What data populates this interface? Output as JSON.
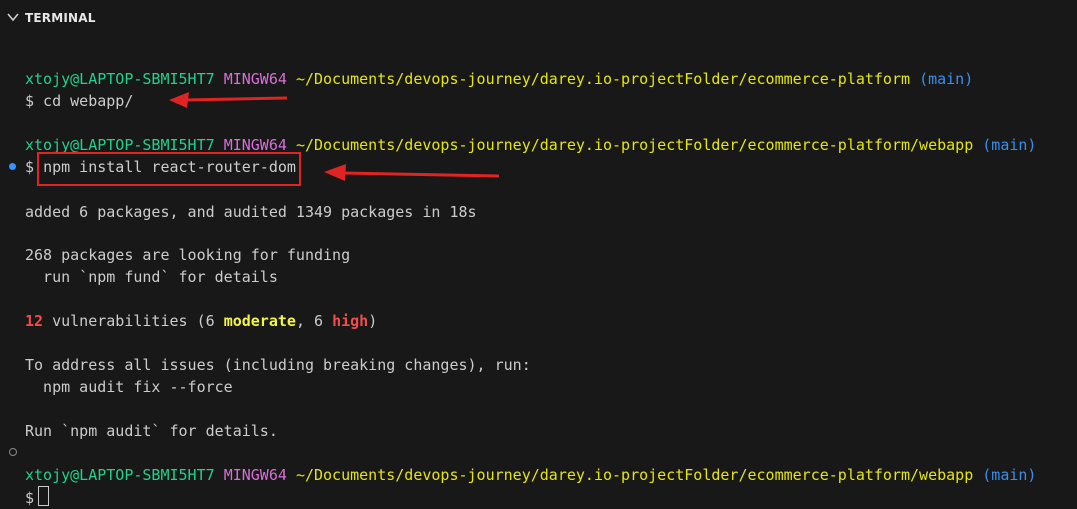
{
  "header": {
    "title": "TERMINAL",
    "icon": "chevron-down-icon"
  },
  "lines": [
    {
      "user": "xtojy@LAPTOP-SBMI5HT7",
      "msys": "MINGW64",
      "path": "~/Documents/devops-journey/darey.io-projectFolder/ecommerce-platform",
      "branch": "(main)"
    },
    {
      "text": "$ cd webapp/"
    },
    {
      "user": "xtojy@LAPTOP-SBMI5HT7",
      "msys": "MINGW64",
      "path": "~/Documents/devops-journey/darey.io-projectFolder/ecommerce-platform/webapp",
      "branch": "(main)"
    },
    {
      "prompt": "$",
      "command": "npm install react-router-dom"
    },
    {
      "text": "added 6 packages, and audited 1349 packages in 18s"
    },
    {
      "text": "268 packages are looking for funding"
    },
    {
      "text": "  run `npm fund` for details"
    },
    {
      "count": "12",
      "mid1": " vulnerabilities (6 ",
      "moderate": "moderate",
      "mid2": ", 6 ",
      "high": "high",
      "end": ")"
    },
    {
      "text": "To address all issues (including breaking changes), run:"
    },
    {
      "text": "  npm audit fix --force"
    },
    {
      "text": "Run `npm audit` for details."
    },
    {
      "user": "xtojy@LAPTOP-SBMI5HT7",
      "msys": "MINGW64",
      "path": "~/Documents/devops-journey/darey.io-projectFolder/ecommerce-platform/webapp",
      "branch": "(main)"
    },
    {
      "prompt": "$"
    }
  ],
  "colors": {
    "background": "#181818",
    "user": "#23d18b",
    "msys": "#d670d6",
    "path": "#e5e510",
    "branch": "#3b8eea",
    "annotation": "#e02424"
  }
}
